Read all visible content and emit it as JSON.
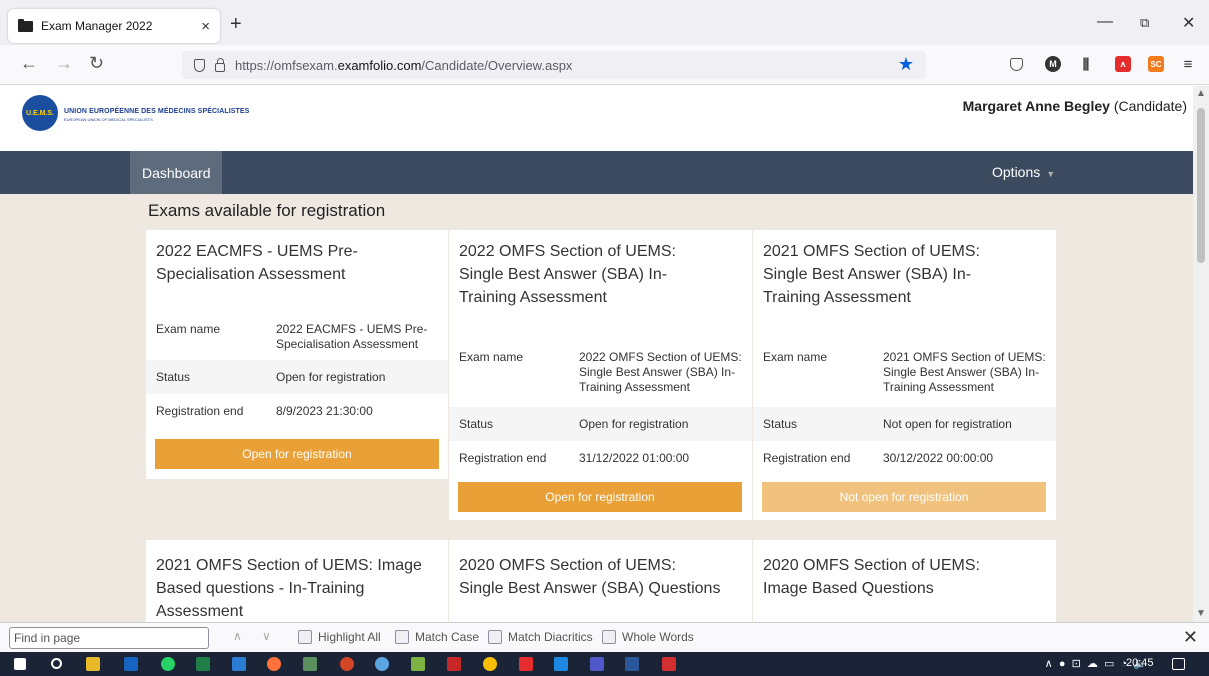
{
  "browser": {
    "tab_title": "Exam Manager 2022",
    "tab_close": "×",
    "new_tab": "+",
    "url_prefix": "https://omfsexam.",
    "url_domain": "examfolio.com",
    "url_path": "/Candidate/Overview.aspx",
    "window_minimize": "—",
    "window_restore": "⧉",
    "window_close": "✕"
  },
  "site": {
    "logo_text": "UNION EUROPÉENNE DES MÉDECINS SPÉCIALISTES",
    "logo_sub": "EUROPEAN UNION OF MEDICAL SPECIALISTS",
    "logo_badge": "U.E.M.S.",
    "user_name": "Margaret Anne Begley",
    "user_role": "(Candidate)"
  },
  "menu": {
    "dashboard": "Dashboard",
    "options": "Options"
  },
  "section_title": "Exams available for registration",
  "labels": {
    "exam_name": "Exam name",
    "status": "Status",
    "registration_end": "Registration end"
  },
  "exams": [
    {
      "title": "2022 EACMFS - UEMS Pre-Specialisation Assessment",
      "exam_name": "2022 EACMFS - UEMS Pre-Specialisation Assessment",
      "status": "Open for registration",
      "registration_end": "8/9/2023 21:30:00",
      "button": "Open for registration"
    },
    {
      "title": "2022 OMFS Section of UEMS: Single Best Answer (SBA) In-Training Assessment",
      "exam_name": "2022 OMFS Section of UEMS: Single Best Answer (SBA) In-Training Assessment",
      "status": "Open for registration",
      "registration_end": "31/12/2022 01:00:00",
      "button": "Open for registration"
    },
    {
      "title": "2021 OMFS Section of UEMS: Single Best Answer (SBA) In-Training Assessment",
      "exam_name": "2021 OMFS Section of UEMS: Single Best Answer (SBA) In-Training Assessment",
      "status": "Not open for registration",
      "registration_end": "30/12/2022 00:00:00",
      "button": "Not open for registration"
    },
    {
      "title": "2021 OMFS Section of UEMS: Image Based questions - In-Training Assessment"
    },
    {
      "title": "2020 OMFS Section of UEMS: Single Best Answer (SBA) Questions"
    },
    {
      "title": "2020 OMFS Section of UEMS: Image Based Questions"
    }
  ],
  "findbar": {
    "placeholder": "Find in page",
    "highlight_all": "Highlight All",
    "match_case": "Match Case",
    "match_diacritics": "Match Diacritics",
    "whole_words": "Whole Words",
    "close": "✕"
  },
  "taskbar": {
    "time": "20:45"
  },
  "colors": {
    "menubar": "#3b4a5e",
    "button_open": "#e8a037",
    "button_closed": "#f0c27e",
    "page_bg": "#eee8e1"
  }
}
